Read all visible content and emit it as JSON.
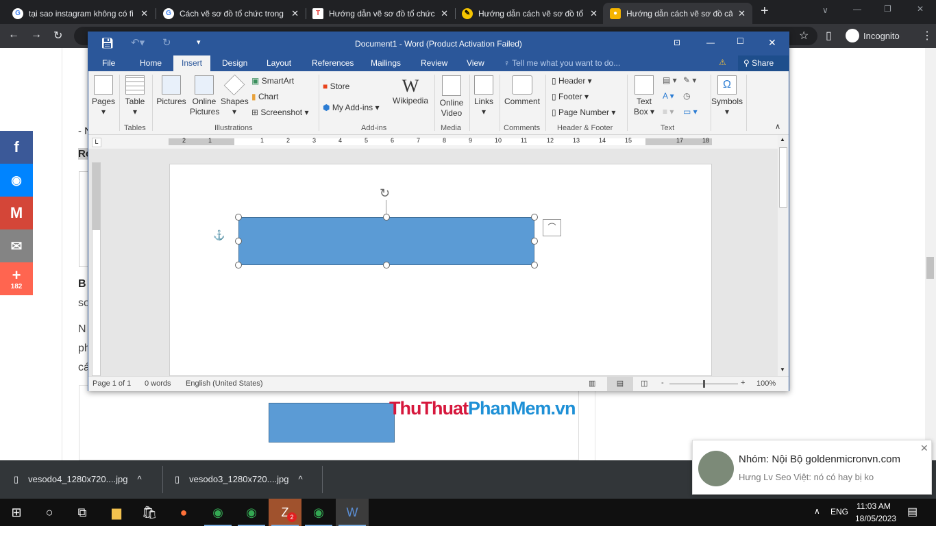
{
  "browser": {
    "tabs": [
      {
        "title": "tại sao instagram không có fi",
        "favicon": "google-icon",
        "active": false
      },
      {
        "title": "Cách vẽ sơ đồ tổ chức trong",
        "favicon": "google-icon",
        "active": false
      },
      {
        "title": "Hướng dẫn vẽ sơ đồ tổ chức",
        "favicon": "site-icon",
        "active": false
      },
      {
        "title": "Hướng dẫn cách vẽ sơ đồ tổ",
        "favicon": "site-icon",
        "active": false
      },
      {
        "title": "Hướng dẫn cách vẽ sơ đồ câ",
        "favicon": "bulb-icon",
        "active": true
      }
    ],
    "new_tab": "+",
    "profile_label": "Incognito"
  },
  "webpage": {
    "share_count": "182",
    "text_fragments": [
      "- N",
      "Rơ",
      "B",
      "so",
      "N",
      "ph",
      "cá"
    ],
    "watermark": {
      "part1": "ThuThuat",
      "part2": "PhanMem",
      "part3": ".vn"
    }
  },
  "word": {
    "title": "Document1 - Word (Product Activation Failed)",
    "tabs": [
      "File",
      "Home",
      "Insert",
      "Design",
      "Layout",
      "References",
      "Mailings",
      "Review",
      "View"
    ],
    "active_tab": "Insert",
    "tell_me_placeholder": "Tell me what you want to do...",
    "share_label": "Share",
    "ribbon": {
      "pages": "Pages",
      "table": "Table",
      "pictures": "Pictures",
      "online_pictures": [
        "Online",
        "Pictures"
      ],
      "shapes": "Shapes",
      "smartart": "SmartArt",
      "chart": "Chart",
      "screenshot": "Screenshot",
      "store": "Store",
      "my_addins": "My Add-ins",
      "wikipedia": "Wikipedia",
      "online_video": [
        "Online",
        "Video"
      ],
      "links": "Links",
      "comment": "Comment",
      "header": "Header",
      "footer": "Footer",
      "page_number": "Page Number",
      "text_box": [
        "Text",
        "Box"
      ],
      "symbols": "Symbols",
      "groups": [
        "Tables",
        "Illustrations",
        "Add-ins",
        "Media",
        "Comments",
        "Header & Footer",
        "Text"
      ]
    },
    "ruler_numbers": [
      "2",
      "1",
      "1",
      "2",
      "3",
      "4",
      "5",
      "6",
      "7",
      "8",
      "9",
      "10",
      "11",
      "12",
      "13",
      "14",
      "15",
      "17",
      "18"
    ],
    "shape_fill": "#5b9bd5",
    "status": {
      "page": "Page 1 of 1",
      "words": "0 words",
      "language": "English (United States)",
      "zoom": "100%"
    },
    "zoom_percent": 100
  },
  "downloads": [
    {
      "name": "vesodo4_1280x720....jpg"
    },
    {
      "name": "vesodo3_1280x720....jpg"
    }
  ],
  "notification": {
    "title": "Nhóm: Nội Bộ goldenmicronvn.com",
    "message": "Hưng Lv Seo Việt: nó có hay bị ko"
  },
  "taskbar": {
    "language": "ENG",
    "time": "11:03 AM",
    "date": "18/05/2023",
    "zalo_badge": "2"
  }
}
